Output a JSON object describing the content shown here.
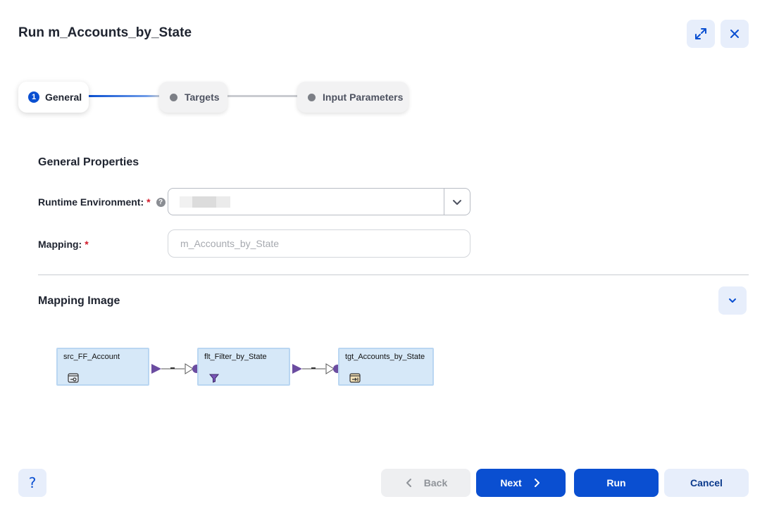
{
  "dialog": {
    "title": "Run m_Accounts_by_State"
  },
  "stepper": {
    "steps": [
      {
        "number": "1",
        "label": "General",
        "state": "active"
      },
      {
        "label": "Targets",
        "state": "pending"
      },
      {
        "label": "Input Parameters",
        "state": "pending"
      }
    ]
  },
  "general": {
    "section_title": "General Properties",
    "runtime_label": "Runtime Environment:",
    "required_mark": "*",
    "help_glyph": "?",
    "mapping_label": "Mapping:",
    "mapping_value": "m_Accounts_by_State"
  },
  "mapping_image": {
    "section_title": "Mapping Image",
    "nodes": [
      {
        "name": "src_FF_Account",
        "icon": "flat-file-source-icon"
      },
      {
        "name": "flt_Filter_by_State",
        "icon": "filter-icon"
      },
      {
        "name": "tgt_Accounts_by_State",
        "icon": "target-icon"
      }
    ]
  },
  "footer": {
    "help_glyph": "?",
    "back_label": "Back",
    "next_label": "Next",
    "run_label": "Run",
    "cancel_label": "Cancel"
  },
  "colors": {
    "primary": "#0a4fd1",
    "secondary_bg": "#e7eefb",
    "node_fill": "#d6e8f8",
    "link_purple": "#6b4ca0",
    "required": "#d11a2a"
  }
}
